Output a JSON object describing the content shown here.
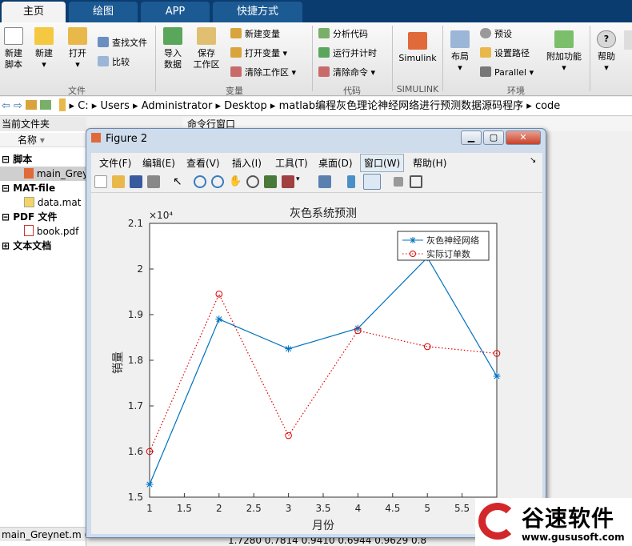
{
  "tabs": [
    {
      "label": "主页",
      "active": true
    },
    {
      "label": "绘图"
    },
    {
      "label": "APP"
    },
    {
      "label": "快捷方式"
    }
  ],
  "ribbon": {
    "new_script": "新建\n脚本",
    "new": "新建",
    "open": "打开",
    "find_files": "查找文件",
    "compare": "比较",
    "import": "导入\n数据",
    "save_ws": "保存\n工作区",
    "new_var": "新建变量",
    "open_var": "打开变量",
    "clear_ws": "清除工作区",
    "analyze": "分析代码",
    "run_time": "运行并计时",
    "clear_cmd": "清除命令",
    "simulink": "Simulink",
    "layout": "布局",
    "prefs": "预设",
    "set_path": "设置路径",
    "parallel": "Parallel",
    "addons": "附加功能",
    "help": "帮助",
    "groups": {
      "file": "文件",
      "variable": "变量",
      "code": "代码",
      "simulink": "SIMULINK",
      "env": "环境"
    }
  },
  "address": {
    "parts": [
      "C:",
      "Users",
      "Administrator",
      "Desktop",
      "matlab编程灰色理论神经网络进行预测数据源码程序",
      "code"
    ]
  },
  "left_panel": {
    "header": "当前文件夹",
    "name_col": "名称",
    "items": [
      {
        "label": "脚本",
        "bold": true
      },
      {
        "label": "main_Greynet.m"
      },
      {
        "label": "MAT-file",
        "bold": true
      },
      {
        "label": "data.mat"
      },
      {
        "label": "PDF 文件",
        "bold": true
      },
      {
        "label": "book.pdf"
      },
      {
        "label": "文本文档",
        "bold": true
      }
    ],
    "footer": "main_Greynet.m (脚本)"
  },
  "command_header": "命令行窗口",
  "bottom_values": "1.7280   0.7814   0.9410   0.6944   0.9629   0.8",
  "figure": {
    "title": "Figure 2",
    "menu": [
      "文件(F)",
      "编辑(E)",
      "查看(V)",
      "插入(I)",
      "工具(T)",
      "桌面(D)",
      "窗口(W)",
      "帮助(H)"
    ]
  },
  "chart_data": {
    "type": "line",
    "title": "灰色系统预测",
    "xlabel": "月份",
    "ylabel": "销量",
    "yscale_label": "×10⁴",
    "xlim": [
      1,
      6
    ],
    "ylim": [
      1.5,
      2.1
    ],
    "xticks": [
      "1",
      "1.5",
      "2",
      "2.5",
      "3",
      "3.5",
      "4",
      "4.5",
      "5",
      "5.5"
    ],
    "yticks": [
      "1.5",
      "1.6",
      "1.7",
      "1.8",
      "1.9",
      "2",
      "2.1"
    ],
    "series": [
      {
        "name": "灰色神经网络",
        "x": [
          1,
          2,
          3,
          4,
          5,
          6
        ],
        "y": [
          1.528,
          1.89,
          1.825,
          1.87,
          2.025,
          1.765
        ],
        "color": "#0072bd",
        "marker": "star",
        "dash": "solid"
      },
      {
        "name": "实际订单数",
        "x": [
          1,
          2,
          3,
          4,
          5,
          6
        ],
        "y": [
          1.6,
          1.945,
          1.635,
          1.865,
          1.83,
          1.815
        ],
        "color": "#e00000",
        "marker": "circle",
        "dash": "dotted"
      }
    ],
    "legend": "top-right",
    "grid": false
  },
  "logo": {
    "text": "谷速软件",
    "url": "www.gususoft.com"
  }
}
